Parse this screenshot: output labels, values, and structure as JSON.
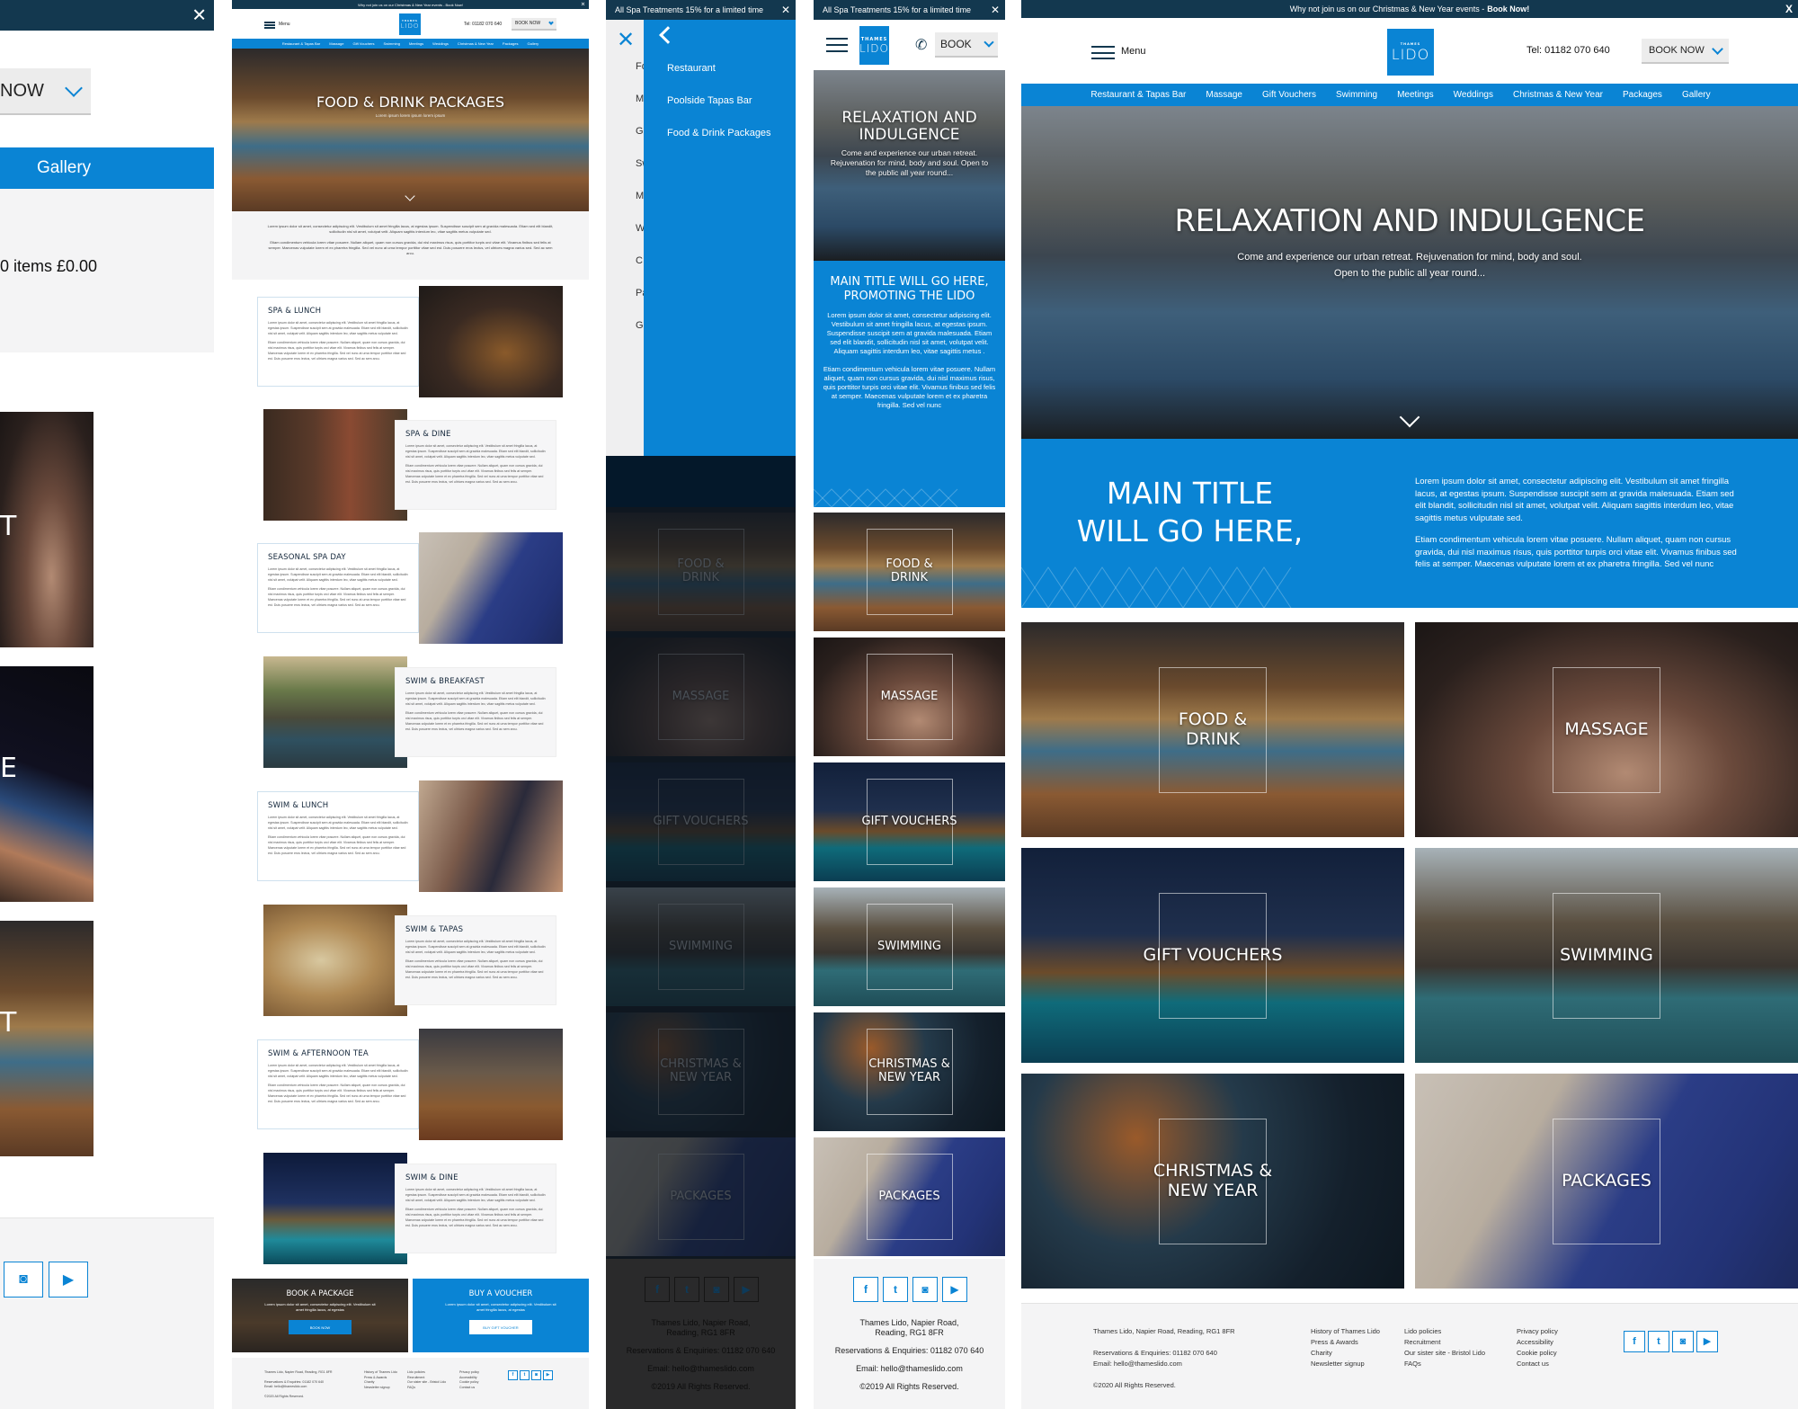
{
  "brand": {
    "logo_small": "THAMES",
    "logo_big": "LIDO",
    "accent": "#0a84d4",
    "navy": "#13384f"
  },
  "desktop_home": {
    "announcement": "Why not join us on our Christmas & New Year events - ",
    "announcement_link": "Book Now!",
    "close": "X",
    "menu_label": "Menu",
    "tel": "Tel: 01182 070 640",
    "book_label": "BOOK NOW",
    "nav": [
      "Restaurant & Tapas Bar",
      "Massage",
      "Gift Vouchers",
      "Swimming",
      "Meetings",
      "Weddings",
      "Christmas & New Year",
      "Packages",
      "Gallery"
    ],
    "hero_title": "RELAXATION AND INDULGENCE",
    "hero_sub_1": "Come and experience our urban retreat. Rejuvenation for mind, body and soul.",
    "hero_sub_2": "Open to the public all year round...",
    "intro_title": "MAIN TITLE WILL GO HERE,",
    "intro_p1": "Lorem ipsum dolor sit amet, consectetur adipiscing elit. Vestibulum sit amet fringilla lacus, at egestas ipsum. Suspendisse suscipit sem at gravida malesuada. Etiam sed elit blandit, sollicitudin nisl sit amet, volutpat velit. Aliquam sagittis interdum leo, vitae sagittis metus vulputate sed.",
    "intro_p2": "Etiam condimentum vehicula lorem vitae posuere. Nullam aliquet, quam non cursus gravida, dui nisl maximus risus, quis porttitor turpis orci vitae elit. Vivamus finibus sed felis at semper. Maecenas vulputate lorem et ex pharetra fringilla. Sed vel nunc",
    "tiles": [
      "FOOD &\nDRINK",
      "MASSAGE",
      "GIFT VOUCHERS",
      "SWIMMING",
      "CHRISTMAS &\nNEW YEAR",
      "PACKAGES"
    ],
    "footer": {
      "address": "Thames Lido, Napier Road, Reading, RG1 8FR",
      "reservations": "Reservations & Enquiries: 01182 070 640",
      "email": "Email: hello@thameslido.com",
      "copyright": "©2020 All Rights Reserved.",
      "col2": [
        "History of Thames Lido",
        "Press & Awards",
        "Charity",
        "Newsletter signup"
      ],
      "col3": [
        "Lido policies",
        "Recruitment",
        "Our sister site - Bristol Lido",
        "FAQs"
      ],
      "col4": [
        "Privacy policy",
        "Accessibility",
        "Cookie policy",
        "Contact us"
      ]
    }
  },
  "social": {
    "facebook": "f",
    "twitter": "t",
    "instagram": "◙",
    "youtube": "▶"
  },
  "mobile_home": {
    "announcement": "All Spa Treatments 15% for a limited time",
    "close": "✕",
    "phone_icon": "✆",
    "book_label": "BOOK",
    "hero_title": "RELAXATION AND INDULGENCE",
    "hero_sub": "Come and experience our urban retreat. Rejuvenation for mind, body and soul. Open to the public all year round...",
    "intro_title": "MAIN TITLE WILL GO HERE, PROMOTING THE LIDO",
    "intro_p1": "Lorem ipsum dolor sit amet, consectetur adipiscing elit. Vestibulum sit amet fringilla lacus, at egestas ipsum. Suspendisse suscipit sem at gravida malesuada. Etiam sed elit blandit, sollicitudin nisl sit amet, volutpat velit. Aliquam sagittis interdum leo, vitae sagittis metus .",
    "intro_p2": "Etiam condimentum vehicula lorem vitae posuere. Nullam aliquet, quam non cursus gravida, dui nisl maximus risus, quis porttitor turpis orci vitae elit. Vivamus finibus sed felis at semper. Maecenas vulputate lorem et ex pharetra fringilla. Sed vel nunc",
    "tiles": [
      "FOOD &\nDRINK",
      "MASSAGE",
      "GIFT VOUCHERS",
      "SWIMMING",
      "CHRISTMAS &\nNEW YEAR",
      "PACKAGES"
    ],
    "footer": {
      "address": "Thames Lido, Napier Road,\nReading, RG1 8FR",
      "reservations": "Reservations & Enquiries: 01182 070 640",
      "email": "Email: hello@thameslido.com",
      "copyright": "©2019 All Rights Reserved."
    }
  },
  "mobile_menu": {
    "announcement": "All Spa Treatments 15% for a limited time",
    "close": "✕",
    "menu_close": "✕",
    "underlay_stubs": [
      "Fo",
      "M",
      "G",
      "Sw",
      "M",
      "W",
      "C",
      "Pa",
      "G"
    ],
    "submenu": [
      "Restaurant",
      "Poolside Tapas Bar",
      "Food & Drink Packages"
    ]
  },
  "food_drink_page": {
    "announcement": "Why not join us on our Christmas & New Year events - Book Now!",
    "close": "✕",
    "menu_label": "Menu",
    "tel": "Tel: 01182 070 640",
    "book_label": "BOOK NOW",
    "nav": [
      "Restaurant & Tapas Bar",
      "Massage",
      "Gift Vouchers",
      "Swimming",
      "Meetings",
      "Weddings",
      "Christmas & New Year",
      "Packages",
      "Gallery"
    ],
    "hero_title": "FOOD & DRINK PACKAGES",
    "hero_sub": "Lorem ipsum lorem ipsum lorem ipsum",
    "intro_p1": "Lorem ipsum dolor sit amet, consectetur adipiscing elit. Vestibulum sit amet fringilla lacus, at egestas ipsum. Suspendisse suscipit sem at gravida malesuada. Etiam sed elit blandit, sollicitudin nisl sit amet, volutpat velit. Aliquam sagittis interdum leo, vitae sagittis metus vulputate sed.",
    "intro_p2": "Etiam condimentum vehicula lorem vitae posuere. Nullam aliquet, quam non cursus gravida, dui nisl maximus risus, quis porttitor turpis orci vitae elit. Vivamus finibus sed felis at semper. Maecenas vulputate lorem et ex pharetra fringilla. Sed vel nunc at urna tempor porttitor vitae sed est. Duis posuere eros lectus, vel ultrices magna varius sed. Sed ac sem arcu.",
    "package_p1": "Lorem ipsum dolor sit amet, consectetur adipiscing elit. Vestibulum sit amet fringilla lacus, at egestas ipsum. Suspendisse suscipit sem at gravida malesuada. Etiam sed elit blandit, sollicitudin nisl sit amet, volutpat velit. Aliquam sagittis interdum leo, vitae sagittis metus vulputate sed.",
    "package_p2": "Etiam condimentum vehicula lorem vitae posuere. Nullam aliquet, quam non cursus gravida, dui nisl maximus risus, quis porttitor turpis orci vitae elit. Vivamus finibus sed felis at semper. Maecenas vulputate lorem et ex pharetra fringilla. Sed vel nunc at urna tempor porttitor vitae sed est. Duis posuere eros lectus, vel ultrices magna varius sed. Sed ac sem arcu.",
    "packages": [
      "SPA & LUNCH",
      "SPA & DINE",
      "SEASONAL SPA DAY",
      "SWIM & BREAKFAST",
      "SWIM & LUNCH",
      "SWIM & TAPAS",
      "SWIM & AFTERNOON TEA",
      "SWIM & DINE"
    ],
    "cta_book_title": "BOOK A PACKAGE",
    "cta_book_text": "Lorem ipsum dolor sit amet, consectetur adipiscing elit. Vestibulum sit amet fringilla lacus, at egestas",
    "cta_book_btn": "BOOK NOW",
    "cta_voucher_title": "BUY A VOUCHER",
    "cta_voucher_text": "Lorem ipsum dolor sit amet, consectetur adipiscing elit. Vestibulum sit amet fringilla lacus, at egestas",
    "cta_voucher_btn": "BUY GIFT VOUCHER",
    "footer": {
      "address": "Thames Lido, Napier Road, Reading, RG1 8FR",
      "reservations": "Reservations & Enquiries: 01182 070 640",
      "email": "Email: hello@thameslido.com",
      "copyright": "©2020 All Rights Reserved.",
      "col2": [
        "History of Thames Lido",
        "Press & Awards",
        "Charity",
        "Newsletter signup"
      ],
      "col3": [
        "Lido policies",
        "Recruitment",
        "Our sister site - Bristol Lido",
        "FAQs"
      ],
      "col4": [
        "Privacy policy",
        "Accessibility",
        "Cookie policy",
        "Contact us"
      ]
    }
  },
  "partial_page": {
    "close": "✕",
    "book_label": "NOW",
    "nav_item": "Gallery",
    "cart": "0 items £0.00",
    "tile_stubs": [
      "T",
      "E",
      "T"
    ]
  }
}
